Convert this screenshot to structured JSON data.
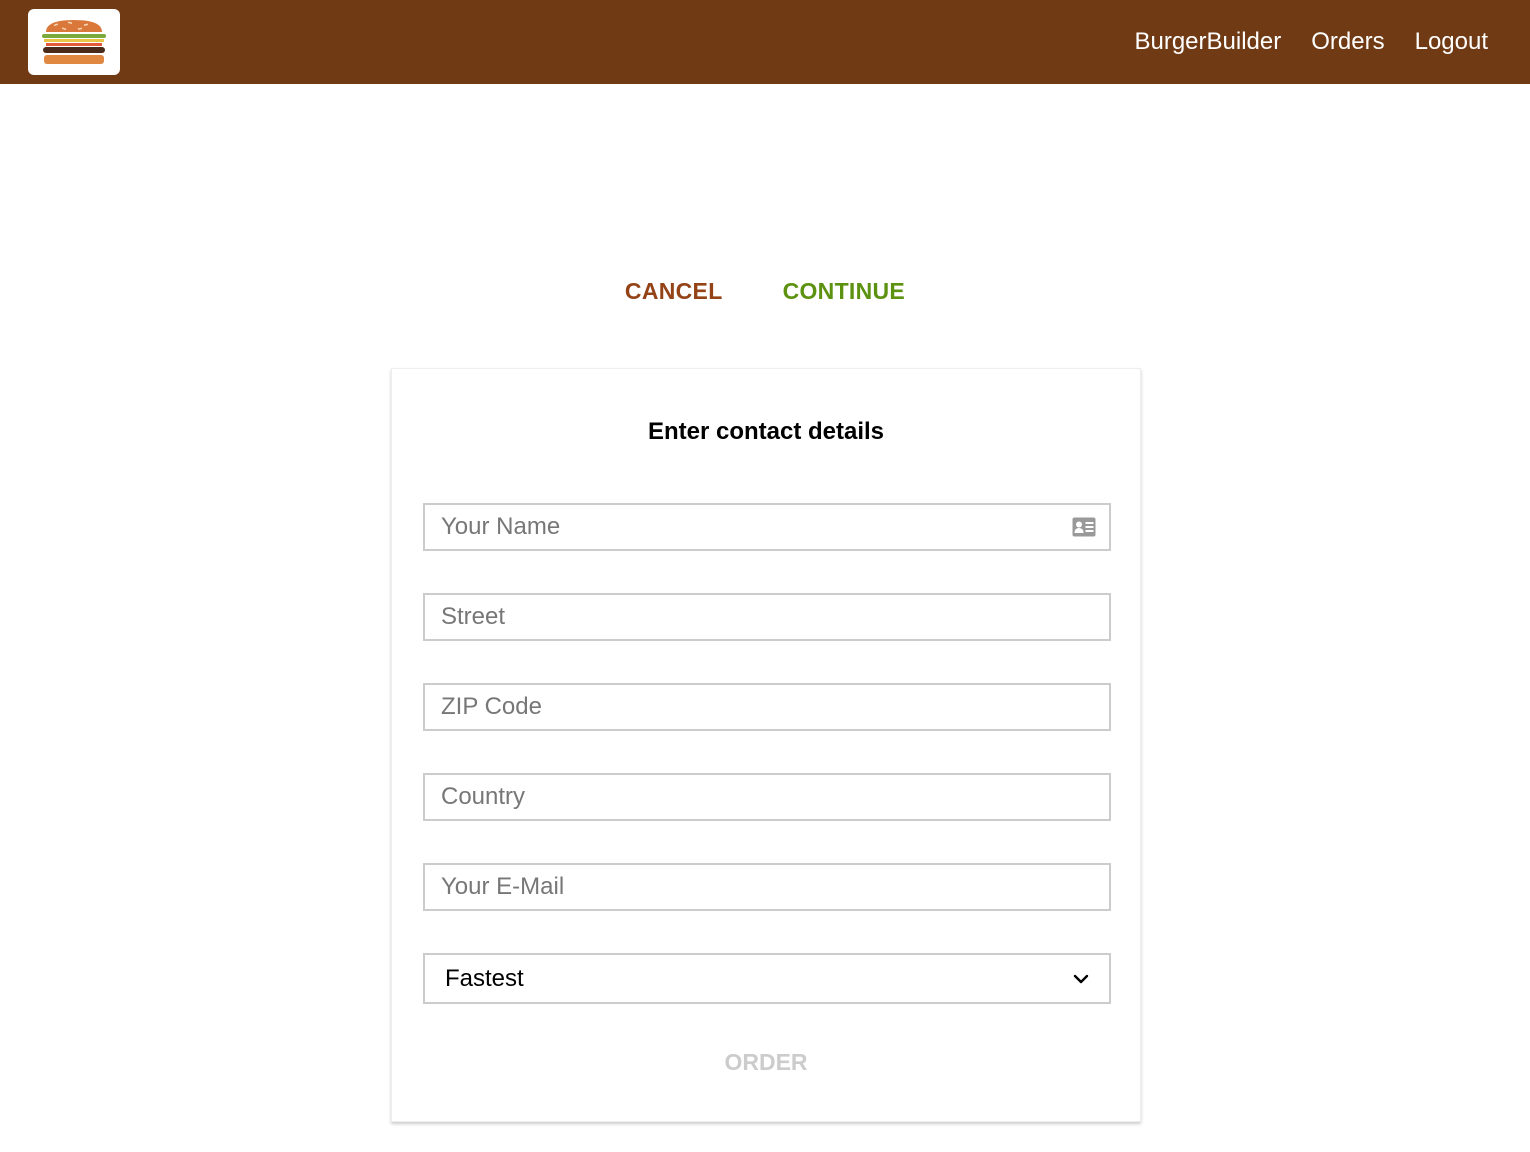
{
  "header": {
    "logo_icon": "burger-logo-icon",
    "nav": [
      {
        "label": "BurgerBuilder"
      },
      {
        "label": "Orders"
      },
      {
        "label": "Logout"
      }
    ],
    "background_color": "#703B14"
  },
  "actions": {
    "cancel_label": "CANCEL",
    "continue_label": "CONTINUE",
    "cancel_color": "#944317",
    "continue_color": "#5C9210"
  },
  "form": {
    "title": "Enter contact details",
    "fields": [
      {
        "placeholder": "Your Name",
        "value": "",
        "icon": "contact-card-icon"
      },
      {
        "placeholder": "Street",
        "value": ""
      },
      {
        "placeholder": "ZIP Code",
        "value": ""
      },
      {
        "placeholder": "Country",
        "value": ""
      },
      {
        "placeholder": "Your E-Mail",
        "value": ""
      }
    ],
    "delivery_method": {
      "selected": "Fastest",
      "icon": "chevron-down-icon"
    },
    "order_label": "ORDER",
    "order_enabled": false
  }
}
